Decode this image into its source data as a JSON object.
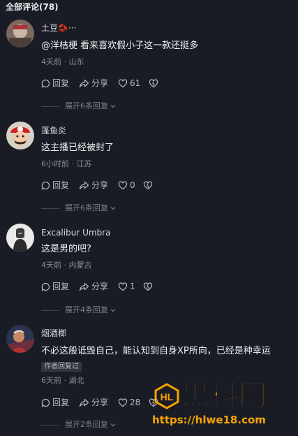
{
  "header": {
    "title": "全部评论(78)"
  },
  "comments": [
    {
      "username": "土豆🫘···",
      "text": "@洋桔梗 看来喜欢假小子这一款还挺多",
      "meta": "4天前 · 山东",
      "reply_label": "回复",
      "share_label": "分享",
      "likes": "61",
      "expand": "展开6条回复"
    },
    {
      "username": "蓬鱼炎",
      "text": "这主播已经被封了",
      "meta": "6小时前 · 江苏",
      "reply_label": "回复",
      "share_label": "分享",
      "likes": "0",
      "expand": "展开6条回复"
    },
    {
      "username": "Excalibur Umbra",
      "text": "这是男的吧?",
      "meta": "4天前 · 内蒙古",
      "reply_label": "回复",
      "share_label": "分享",
      "likes": "1",
      "expand": "展开4条回复"
    },
    {
      "username": "烟酒榔",
      "text": "不必这般诋毁自己，能认知到自身XP所向，已经是种幸运",
      "badge": "作者回复过",
      "meta": "6天前 · 湖北",
      "reply_label": "回复",
      "share_label": "分享",
      "likes": "28",
      "expand": "展开2条回复"
    }
  ],
  "watermark": {
    "title": "黑料网",
    "url": "https://hlwe18.com"
  },
  "colors": {
    "background": "#1a1c25",
    "watermark": "#f5a400"
  }
}
